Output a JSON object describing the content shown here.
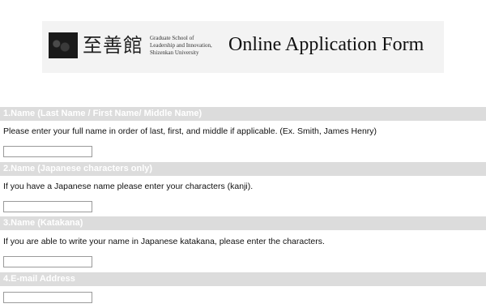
{
  "header": {
    "logo_kanji": "至善館",
    "logo_lines": [
      "Graduate School of",
      "Leadership and Innovation,",
      "Shizenkan University"
    ],
    "title": "Online Application Form"
  },
  "sections": [
    {
      "heading": "1.Name (Last Name / First Name/ Middle Name)",
      "instruction": "Please enter your full name in order of last, first, and middle if applicable. (Ex. Smith, James Henry)",
      "input_value": ""
    },
    {
      "heading": "2.Name (Japanese characters only)",
      "instruction": "If you have a Japanese name please enter your characters (kanji).",
      "input_value": ""
    },
    {
      "heading": "3.Name (Katakana)",
      "instruction": "If you are able to write your name in Japanese katakana, please enter the characters.",
      "input_value": ""
    },
    {
      "heading": "4.E-mail Address",
      "instruction": "",
      "input_value": ""
    }
  ],
  "colors": {
    "section_header_bg": "#dcdcdc",
    "section_header_text": "#ffffff",
    "input_border": "#9a9a9a"
  }
}
